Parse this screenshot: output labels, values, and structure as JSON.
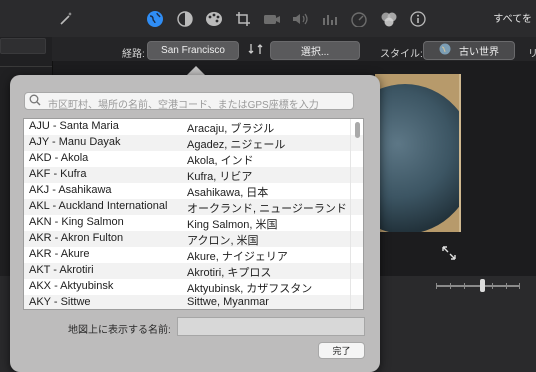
{
  "toolbar": {
    "icons": [
      "magic-wand-icon",
      "globe-icon",
      "contrast-icon",
      "palette-icon",
      "crop-icon",
      "camera-icon",
      "volume-icon",
      "equalizer-icon",
      "speedometer-icon",
      "filters-icon",
      "info-icon"
    ],
    "select_all": "すべてを"
  },
  "route": {
    "label": "経路:",
    "from": "San Francisco",
    "select": "選択...",
    "style_label": "スタイル:",
    "style_value": "古い世界",
    "edge_char": "リ"
  },
  "popover": {
    "search_placeholder": "市区町村、場所の名前、空港コード、またはGPS座標を入力",
    "rows": [
      {
        "code": "AJU - Santa Maria",
        "city": "Aracaju, ブラジル"
      },
      {
        "code": "AJY - Manu Dayak",
        "city": "Agadez, ニジェール"
      },
      {
        "code": "AKD - Akola",
        "city": "Akola, インド"
      },
      {
        "code": "AKF - Kufra",
        "city": "Kufra, リビア"
      },
      {
        "code": "AKJ - Asahikawa",
        "city": "Asahikawa, 日本"
      },
      {
        "code": "AKL - Auckland International",
        "city": "オークランド, ニュージーランド"
      },
      {
        "code": "AKN - King Salmon",
        "city": "King Salmon, 米国"
      },
      {
        "code": "AKR - Akron Fulton",
        "city": "アクロン, 米国"
      },
      {
        "code": "AKR - Akure",
        "city": "Akure, ナイジェリア"
      },
      {
        "code": "AKT - Akrotiri",
        "city": "Akrotiri, キプロス"
      },
      {
        "code": "AKX - Aktyubinsk",
        "city": "Aktyubinsk, カザフスタン"
      },
      {
        "code": "AKY - Sittwe",
        "city": "Sittwe, Myanmar"
      }
    ],
    "name_label": "地図上に表示する名前:",
    "name_value": "",
    "done": "完了"
  }
}
